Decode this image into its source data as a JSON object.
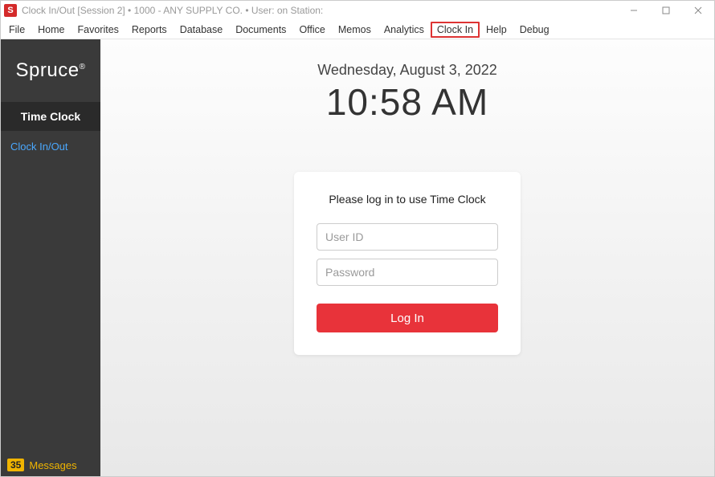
{
  "window": {
    "title": "Clock In/Out [Session 2]   •   1000 - ANY SUPPLY CO.   •   User:                on Station:"
  },
  "menu": {
    "items": [
      "File",
      "Home",
      "Favorites",
      "Reports",
      "Database",
      "Documents",
      "Office",
      "Memos",
      "Analytics",
      "Clock In",
      "Help",
      "Debug"
    ],
    "highlight_index": 9
  },
  "sidebar": {
    "logo": "Spruce",
    "section": "Time Clock",
    "link": "Clock In/Out",
    "messages_count": "35",
    "messages_label": "Messages"
  },
  "main": {
    "date": "Wednesday, August 3, 2022",
    "time": "10:58 AM",
    "login_prompt": "Please log in to use Time Clock",
    "user_id_placeholder": "User ID",
    "password_placeholder": "Password",
    "login_button": "Log In"
  }
}
